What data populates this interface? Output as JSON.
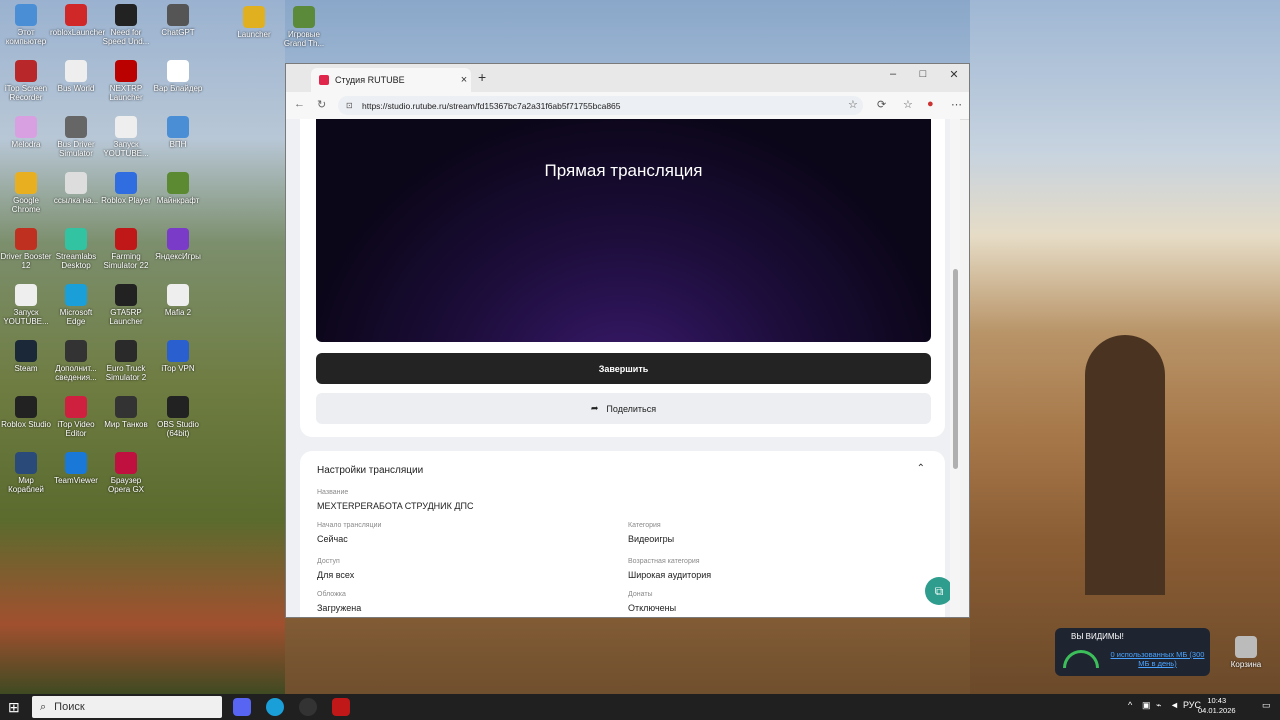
{
  "desktop": {
    "icons_left": [
      {
        "label": "Этот компьютер",
        "icon": "computer-icon",
        "color": "#4a8fd6"
      },
      {
        "label": "robloxLauncher",
        "icon": "roblox-icon",
        "color": "#d02828"
      },
      {
        "label": "Need for Speed Und...",
        "icon": "nfs-icon",
        "color": "#222"
      },
      {
        "label": "ChatGPT",
        "icon": "chatgpt-icon",
        "color": "#555"
      },
      {
        "label": "iTop Screen Recorder",
        "icon": "itop-recorder-icon",
        "color": "#b8282a"
      },
      {
        "label": "Bus World",
        "icon": "busworld-icon",
        "color": "#eee"
      },
      {
        "label": "NEXTRP Launcher",
        "icon": "nextrp-icon",
        "color": "#b00"
      },
      {
        "label": "Вар Блайдер",
        "icon": "warblader-icon",
        "color": "#fff"
      },
      {
        "label": "Melodra",
        "icon": "melodra-icon",
        "color": "#d8a0e0"
      },
      {
        "label": "Bus Driver Simulator",
        "icon": "busdriver-icon",
        "color": "#666"
      },
      {
        "label": "Запуск YOUTUBE...",
        "icon": "file-icon",
        "color": "#eee"
      },
      {
        "label": "ВПН",
        "icon": "vpn-icon",
        "color": "#4a8fd6"
      },
      {
        "label": "Google Chrome",
        "icon": "chrome-icon",
        "color": "#e8b020"
      },
      {
        "label": "ссылка на...",
        "icon": "file-icon",
        "color": "#ddd"
      },
      {
        "label": "Roblox Player",
        "icon": "roblox-player-icon",
        "color": "#2f6de0"
      },
      {
        "label": "Майнкрафт",
        "icon": "minecraft-icon",
        "color": "#5b8a32"
      },
      {
        "label": "Driver Booster 12",
        "icon": "driverbooster-icon",
        "color": "#c03020"
      },
      {
        "label": "Streamlabs Desktop",
        "icon": "streamlabs-icon",
        "color": "#31c3a2"
      },
      {
        "label": "Farming Simulator 22",
        "icon": "farming-icon",
        "color": "#c01818"
      },
      {
        "label": "ЯндексИгры",
        "icon": "yandexgames-icon",
        "color": "#7a3cc8"
      },
      {
        "label": "Запуск YOUTUBE...",
        "icon": "file-icon",
        "color": "#eee"
      },
      {
        "label": "Microsoft Edge",
        "icon": "edge-icon",
        "color": "#1a9fd8"
      },
      {
        "label": "GTA5RP Launcher",
        "icon": "gta5rp-icon",
        "color": "#222"
      },
      {
        "label": "Mafia 2",
        "icon": "file-icon",
        "color": "#eee"
      },
      {
        "label": "Steam",
        "icon": "steam-icon",
        "color": "#1b2838"
      },
      {
        "label": "Дополнит... сведения...",
        "icon": "info-icon",
        "color": "#333"
      },
      {
        "label": "Euro Truck Simulator 2",
        "icon": "ets2-icon",
        "color": "#2a2a2a"
      },
      {
        "label": "iTop VPN",
        "icon": "itop-vpn-icon",
        "color": "#2a5fd0"
      },
      {
        "label": "Roblox Studio",
        "icon": "roblox-studio-icon",
        "color": "#222"
      },
      {
        "label": "iTop Video Editor",
        "icon": "itop-video-icon",
        "color": "#d02040"
      },
      {
        "label": "Мир Танков",
        "icon": "tanks-icon",
        "color": "#333"
      },
      {
        "label": "OBS Studio (64bit)",
        "icon": "obs-icon",
        "color": "#222"
      },
      {
        "label": "Мир Кораблей",
        "icon": "ships-icon",
        "color": "#2a4a7a"
      },
      {
        "label": "TeamViewer",
        "icon": "teamviewer-icon",
        "color": "#1a78d8"
      },
      {
        "label": "Браузер Opera GX",
        "icon": "operagx-icon",
        "color": "#c01040"
      }
    ],
    "icons_top": [
      {
        "label": "Launcher",
        "icon": "launcher-icon",
        "color": "#e0b020"
      },
      {
        "label": "Игровые Grand Th...",
        "icon": "gta-icon",
        "color": "#5a8a3a"
      }
    ],
    "icons_right": [
      {
        "label": "Корзина",
        "icon": "recycle-bin-icon",
        "color": "#bbb"
      }
    ]
  },
  "browser": {
    "tab_title": "Студия RUTUBE",
    "url": "https://studio.rutube.ru/stream/fd15367bc7a2a31f6ab5f71755bca865",
    "window_controls": {
      "minimize": "–",
      "maximize": "□",
      "close": "✕"
    }
  },
  "page": {
    "player_title": "Прямая трансляция",
    "finish_button": "Завершить",
    "share_button": "Поделиться",
    "settings": {
      "title": "Настройки трансляции",
      "name_label": "Название",
      "name_value": "MEXTERPERAБOTA СТРУДНИК ДПС",
      "start_label": "Начало трансляции",
      "start_value": "Сейчас",
      "category_label": "Категория",
      "category_value": "Видеоигры",
      "access_label": "Доступ",
      "access_value": "Для всех",
      "age_label": "Возрастная категория",
      "age_value": "Широкая аудитория",
      "cover_label": "Обложка",
      "cover_value": "Загружена",
      "donations_label": "Донаты",
      "donations_value": "Отключены"
    }
  },
  "widget": {
    "title": "ВЫ ВИДИМЫ!",
    "usage": "0 использованных МБ (300 МБ в день)"
  },
  "taskbar": {
    "search_placeholder": "Поиск",
    "language": "РУС",
    "time": "10:43",
    "date": "04.01.2026"
  },
  "colors": {
    "accent_fab": "#2e9d8e",
    "finish_button_bg": "#232323",
    "rutube_brand": "#e0264b"
  }
}
